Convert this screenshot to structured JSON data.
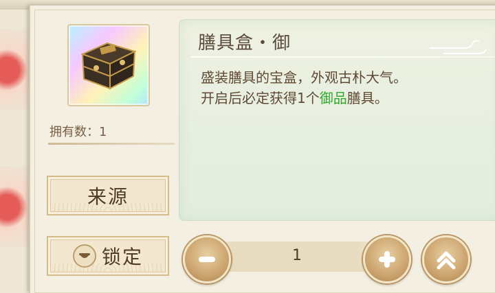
{
  "item": {
    "name": "膳具盒・御",
    "owned_label": "拥有数：1",
    "description_line1": "盛装膳具的宝盒，外观古朴大气。",
    "description_line2_pre": "开启后必定获得1个",
    "description_line2_highlight": "御品",
    "description_line2_post": "膳具。"
  },
  "buttons": {
    "source_label": "来源",
    "lock_label": "锁定"
  },
  "quantity": {
    "value": "1"
  },
  "colors": {
    "highlight": "#2ea82b",
    "text_brown": "#5f4934",
    "button_gold": "#c9a06a"
  },
  "icons": {
    "item": "treasure-chest-icon",
    "lock": "lock-icon",
    "decrease": "minus-icon",
    "increase": "plus-icon",
    "max": "double-chevron-up-icon"
  }
}
